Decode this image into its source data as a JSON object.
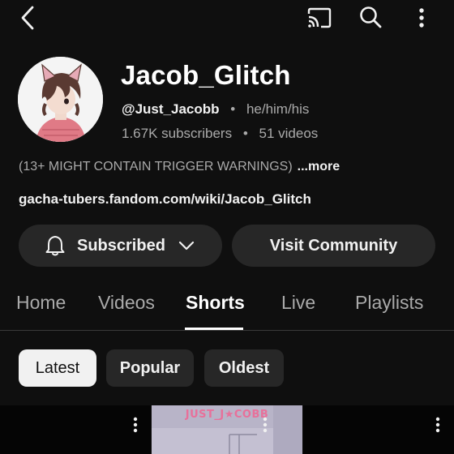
{
  "topbar": {
    "back_icon": "back-arrow-icon",
    "cast_icon": "cast-icon",
    "search_icon": "search-icon",
    "more_icon": "more-vertical-icon"
  },
  "channel": {
    "name": "Jacob_Glitch",
    "handle": "@Just_Jacobb",
    "pronouns": "he/him/his",
    "subscribers": "1.67K subscribers",
    "videos": "51 videos",
    "description": "(13+ MIGHT CONTAIN TRIGGER WARNINGS)",
    "more_label": "...more",
    "link": "gacha-tubers.fandom.com/wiki/Jacob_Glitch"
  },
  "actions": {
    "subscribed_label": "Subscribed",
    "community_label": "Visit Community"
  },
  "tabs": [
    {
      "label": "Home"
    },
    {
      "label": "Videos"
    },
    {
      "label": "Shorts",
      "active": true
    },
    {
      "label": "Live"
    },
    {
      "label": "Playlists"
    }
  ],
  "filters": [
    {
      "label": "Latest",
      "selected": true
    },
    {
      "label": "Popular"
    },
    {
      "label": "Oldest"
    }
  ],
  "shorts": [
    {
      "overlay": ""
    },
    {
      "overlay": "JUST_J★COBB"
    },
    {
      "overlay": ""
    }
  ],
  "colors": {
    "background": "#0f0f0f",
    "surface": "#272727",
    "text_primary": "#f1f1f1",
    "text_secondary": "#aaaaaa",
    "chip_selected_bg": "#f1f1f1"
  }
}
